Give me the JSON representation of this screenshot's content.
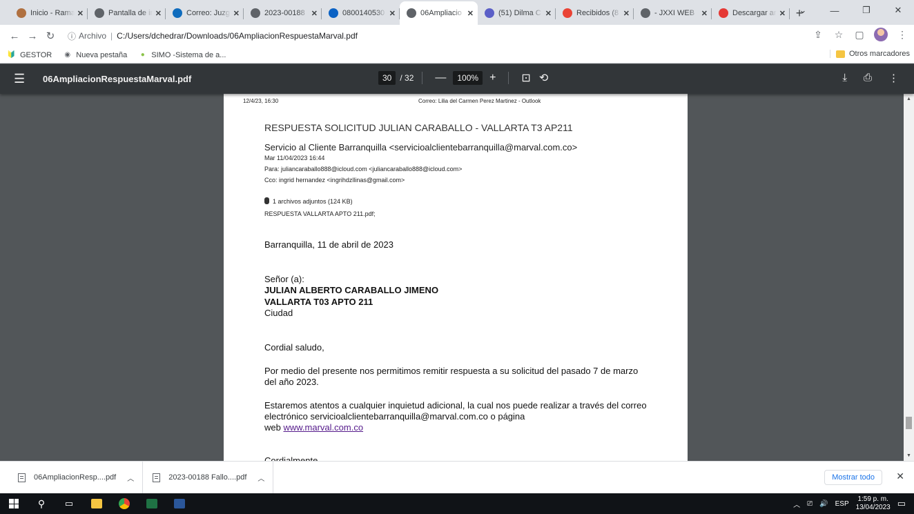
{
  "tabs": [
    {
      "title": "Inicio - Rama",
      "color": "#b07040"
    },
    {
      "title": "Pantalla de in",
      "color": "#5f6368"
    },
    {
      "title": "Correo: Juzg",
      "color": "#0f6cbd"
    },
    {
      "title": "2023-00188",
      "color": "#5f6368"
    },
    {
      "title": "0800140530",
      "color": "#0b62c4"
    },
    {
      "title": "06Ampliacio",
      "color": "#5f6368",
      "active": true
    },
    {
      "title": "(51) Dilma C",
      "color": "#5b5fc7"
    },
    {
      "title": "Recibidos (8",
      "color": "#ea4335"
    },
    {
      "title": "- JXXI WEB",
      "color": "#5f6368"
    },
    {
      "title": "Descargar ar",
      "color": "#e53935"
    }
  ],
  "omnibox": {
    "scheme": "Archivo",
    "path": "C:/Users/dchedrar/Downloads/06AmpliacionRespuestaMarval.pdf"
  },
  "bookmarks": [
    {
      "label": "GESTOR",
      "icon": "gestor-icon"
    },
    {
      "label": "Nueva pestaña",
      "icon": "globe-icon"
    },
    {
      "label": "SIMO -Sistema de a...",
      "icon": "leaf-icon"
    }
  ],
  "bookmarks_other": "Otros marcadores",
  "pdf": {
    "filename": "06AmpliacionRespuestaMarval.pdf",
    "current_page": "30",
    "total_pages": "/ 32",
    "zoom": "100%"
  },
  "page": {
    "header_left": "12/4/23, 16:30",
    "header_center": "Correo: Lilia del Carmen Perez Martinez - Outlook",
    "subject": "RESPUESTA SOLICITUD JULIAN CARABALLO - VALLARTA T3 AP211",
    "sender": "Servicio al Cliente Barranquilla <servicioalclientebarranquilla@marval.com.co>",
    "date": "Mar 11/04/2023 16:44",
    "to": "Para: juliancaraballo888@icloud.com <juliancaraballo888@icloud.com>",
    "cc": "Cco: ingrid hernandez <ingrihdzllinas@gmail.com>",
    "attachments": "1 archivos adjuntos (124 KB)",
    "attachment_name": "RESPUESTA VALLARTA APTO 211.pdf;",
    "place_date": "Barranquilla,  11  de abril  de 2023",
    "salutation_title": "Señor (a):",
    "recipient_name": "JULIAN ALBERTO CARABALLO JIMENO",
    "recipient_address": "VALLARTA  T03 APTO 211",
    "recipient_city": "Ciudad",
    "greeting": "Cordial saludo,",
    "para1": "Por medio del presente nos permitimos remitir respuesta a su solicitud del pasado 7 de marzo del año 2023.",
    "para2": "Estaremos atentos a cualquier inquietud adicional, la cual nos puede realizar a través del correo electrónico servicioalclientebarranquilla@marval.com.co o página",
    "para2_web": "web",
    "link": "www.marval.com.co",
    "closing": "Cordialmente"
  },
  "downloads": [
    {
      "name": "06AmpliacionResp....pdf"
    },
    {
      "name": "2023-00188  Fallo....pdf"
    }
  ],
  "show_all": "Mostrar todo",
  "taskbar": {
    "lang": "ESP",
    "time": "1:59 p. m.",
    "date": "13/04/2023"
  }
}
